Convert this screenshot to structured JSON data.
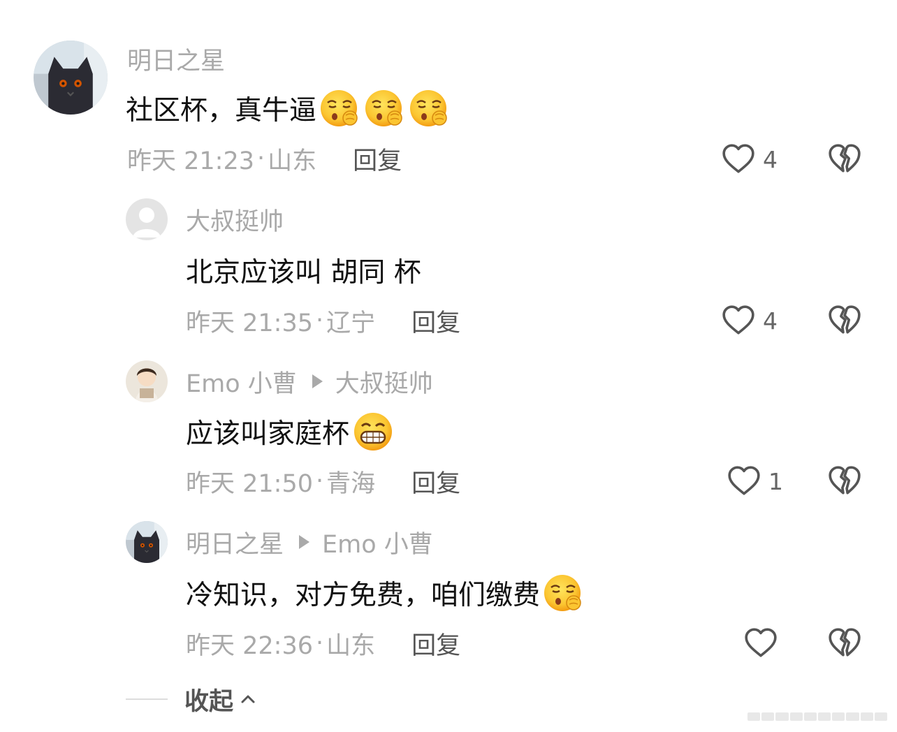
{
  "comments": [
    {
      "name": "明日之星",
      "text": "社区杯，真牛逼",
      "emojis": [
        "shush-face",
        "shush-face",
        "shush-face"
      ],
      "time": "昨天 21:23",
      "location": "山东",
      "reply_label": "回复",
      "likes": "4"
    },
    {
      "name": "大叔挺帅",
      "text": "北京应该叫 胡同 杯",
      "time": "昨天 21:35",
      "location": "辽宁",
      "reply_label": "回复",
      "likes": "4"
    },
    {
      "name": "Emo 小曹",
      "reply_to": "大叔挺帅",
      "text": "应该叫家庭杯",
      "emojis": [
        "grin-face"
      ],
      "time": "昨天 21:50",
      "location": "青海",
      "reply_label": "回复",
      "likes": "1"
    },
    {
      "name": "明日之星",
      "reply_to": "Emo 小曹",
      "text": "冷知识，对方免费，咱们缴费",
      "emojis": [
        "shush-face"
      ],
      "time": "昨天 22:36",
      "location": "山东",
      "reply_label": "回复",
      "likes": ""
    }
  ],
  "collapse_label": "收起",
  "colors": {
    "meta_gray": "#a9a9a9",
    "text": "#111111",
    "icon_gray": "#555555"
  }
}
